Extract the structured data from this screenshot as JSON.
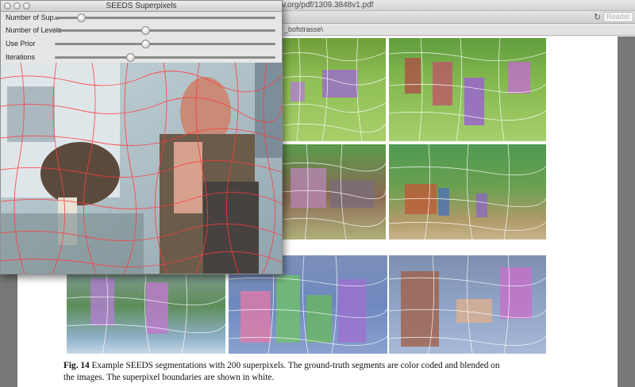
{
  "browser": {
    "url_fragment": "v.org/pdf/1309.3848v1.pdf",
    "reader_label": "Reader",
    "reload_icon": "reload-icon",
    "bookmark_fragment": "_bofstrasse\\"
  },
  "seeds_window": {
    "title": "SEEDS Superpixels",
    "controls": [
      {
        "label": "Number of Sup...",
        "value": 0.12
      },
      {
        "label": "Number of Levels",
        "value": 0.41
      },
      {
        "label": "Use Prior",
        "value": 0.41
      },
      {
        "label": "Iterations",
        "value": 0.34
      }
    ]
  },
  "figure": {
    "caption_label": "Fig. 14",
    "caption_line1": "Example SEEDS segmentations with 200 superpixels. The ground-truth segments are color coded and blended on",
    "caption_line2": "the images. The superpixel boundaries are shown in white."
  }
}
